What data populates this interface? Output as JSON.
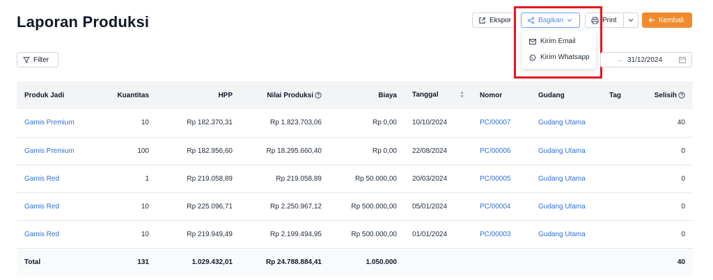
{
  "header": {
    "title": "Laporan Produksi",
    "export_label": "Ekspor",
    "share_label": "Bagikan",
    "print_label": "Print",
    "back_label": "Kembali"
  },
  "share_menu": {
    "items": [
      {
        "label": "Kirim Email",
        "icon": "mail-icon"
      },
      {
        "label": "Kirim Whatsapp",
        "icon": "whatsapp-icon"
      }
    ]
  },
  "filter": {
    "label": "Filter",
    "date_separator": "→",
    "date_end": "31/12/2024"
  },
  "colors": {
    "accent": "#f08c2e",
    "link": "#2f6fd6",
    "highlight": "#e8141c"
  },
  "table": {
    "columns": [
      "Produk Jadi",
      "Kuantitas",
      "HPP",
      "Nilai Produksi",
      "Biaya",
      "Tanggal",
      "Nomor",
      "Gudang",
      "Tag",
      "Selisih"
    ],
    "rows": [
      {
        "produk": "Gamis Premium",
        "kuantitas": "10",
        "hpp": "Rp 182.370,31",
        "nilai": "Rp 1.823.703,06",
        "biaya": "Rp 0,00",
        "tanggal": "10/10/2024",
        "nomor": "PC/00007",
        "gudang": "Gudang Utama",
        "tag": "",
        "selisih": "40"
      },
      {
        "produk": "Gamis Premium",
        "kuantitas": "100",
        "hpp": "Rp 182.956,60",
        "nilai": "Rp 18.295.660,40",
        "biaya": "Rp 0,00",
        "tanggal": "22/08/2024",
        "nomor": "PC/00006",
        "gudang": "Gudang Utama",
        "tag": "",
        "selisih": "0"
      },
      {
        "produk": "Gamis Red",
        "kuantitas": "1",
        "hpp": "Rp 219.058,89",
        "nilai": "Rp 219.058,89",
        "biaya": "Rp 50.000,00",
        "tanggal": "20/03/2024",
        "nomor": "PC/00005",
        "gudang": "Gudang Utama",
        "tag": "",
        "selisih": "0"
      },
      {
        "produk": "Gamis Red",
        "kuantitas": "10",
        "hpp": "Rp 225.096,71",
        "nilai": "Rp 2.250.967,12",
        "biaya": "Rp 500.000,00",
        "tanggal": "05/01/2024",
        "nomor": "PC/00004",
        "gudang": "Gudang Utama",
        "tag": "",
        "selisih": "0"
      },
      {
        "produk": "Gamis Red",
        "kuantitas": "10",
        "hpp": "Rp 219.949,49",
        "nilai": "Rp 2.199.494,95",
        "biaya": "Rp 500.000,00",
        "tanggal": "01/01/2024",
        "nomor": "PC/00003",
        "gudang": "Gudang Utama",
        "tag": "",
        "selisih": "0"
      }
    ],
    "total": {
      "label": "Total",
      "kuantitas": "131",
      "hpp": "1.029.432,01",
      "nilai": "Rp 24.788.884,41",
      "biaya": "1.050.000",
      "selisih": "40"
    }
  }
}
